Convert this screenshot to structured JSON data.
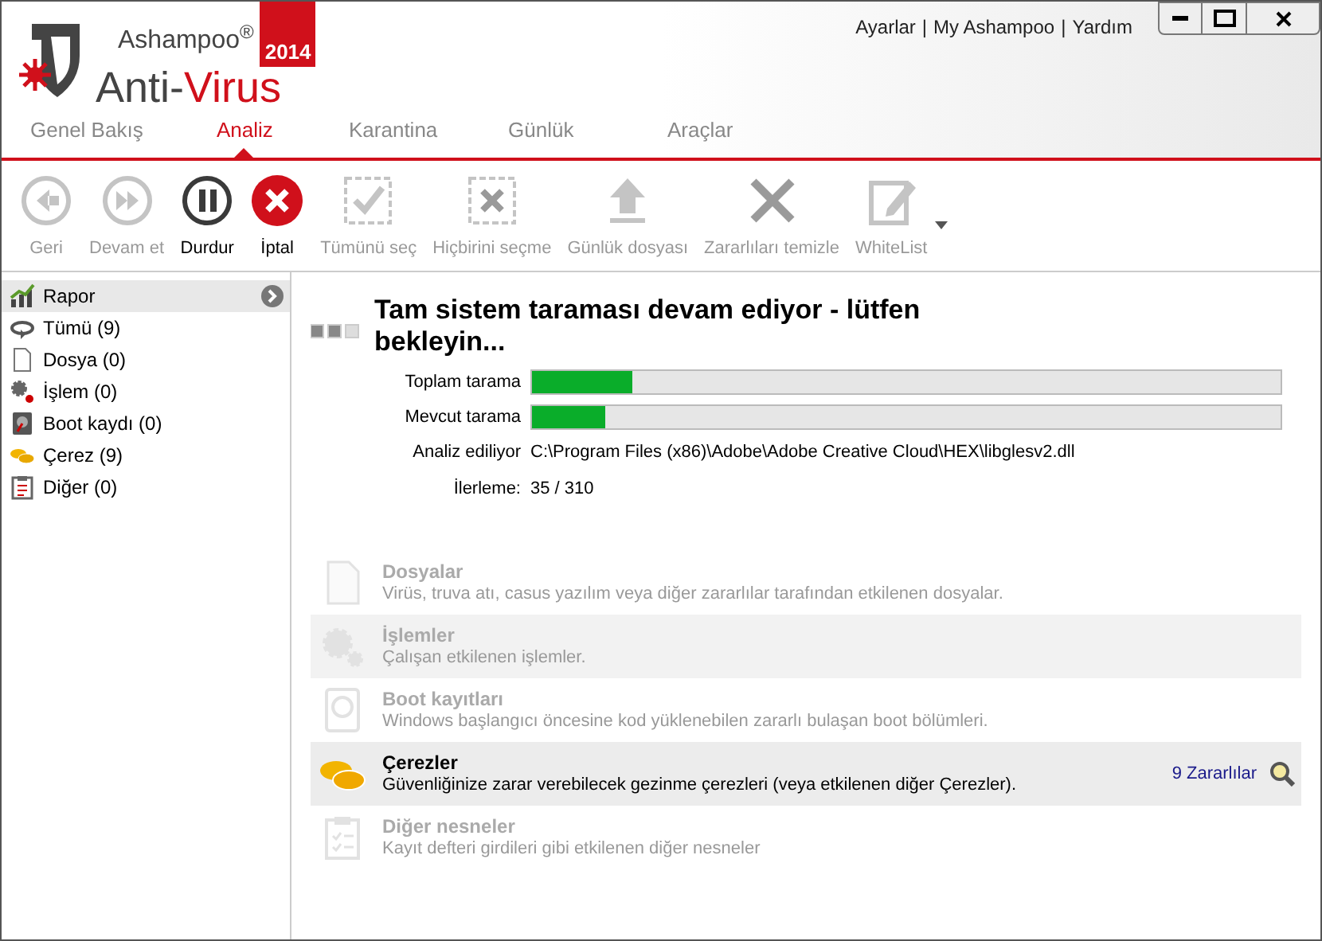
{
  "header": {
    "brand": "Ashampoo$^{®}$",
    "product_part_1": "Anti-",
    "product_part_2": "Virus",
    "year": "2014",
    "links": [
      "Ayarlar",
      "My Ashampoo",
      "Yardım"
    ],
    "separator": "|"
  },
  "tabs": [
    {
      "label": "Genel Bakış",
      "selected": false
    },
    {
      "label": "Analiz",
      "selected": true
    },
    {
      "label": "Karantina",
      "selected": false
    },
    {
      "label": "Günlük",
      "selected": false
    },
    {
      "label": "Araçlar",
      "selected": false
    }
  ],
  "toolbar": [
    {
      "kind": "back",
      "label": "Geri",
      "enabled": false
    },
    {
      "kind": "forward",
      "label": "Devam et",
      "enabled": false
    },
    {
      "kind": "pause",
      "label": "Durdur",
      "enabled": true
    },
    {
      "kind": "cancel",
      "label": "İptal",
      "enabled": true
    },
    {
      "kind": "check",
      "label": "Tümünü seç",
      "enabled": false
    },
    {
      "kind": "uncheck",
      "label": "Hiçbirini seçme",
      "enabled": false
    },
    {
      "kind": "upload",
      "label": "Günlük dosyası",
      "enabled": false
    },
    {
      "kind": "clean",
      "label": "Zararlıları temizle",
      "enabled": false
    },
    {
      "kind": "edit",
      "label": "WhiteList",
      "enabled": false
    }
  ],
  "sidebar": {
    "items": [
      {
        "kind": "report",
        "label": "Rapor",
        "selected": true
      },
      {
        "kind": "all",
        "label": "Tümü (9)",
        "selected": false
      },
      {
        "kind": "file",
        "label": "Dosya (0)",
        "selected": false
      },
      {
        "kind": "process",
        "label": "İşlem (0)",
        "selected": false
      },
      {
        "kind": "boot",
        "label": "Boot kaydı (0)",
        "selected": false
      },
      {
        "kind": "cookie",
        "label": "Çerez (9)",
        "selected": false
      },
      {
        "kind": "other",
        "label": "Diğer (0)",
        "selected": false
      }
    ]
  },
  "scan": {
    "title": "Tam sistem taraması devam ediyor - lütfen bekleyin...",
    "progress": [
      {
        "label": "Toplam tarama",
        "level": 0.135
      },
      {
        "label": "Mevcut tarama",
        "level": 0.098
      }
    ],
    "details": [
      {
        "label": "Analiz ediliyor",
        "value": "C:\\Program Files (x86)\\Adobe\\Adobe Creative Cloud\\HEX\\libglesv2.dll"
      },
      {
        "label": "İlerleme:",
        "value": "35 / 310"
      }
    ]
  },
  "categories": [
    {
      "kind": "file",
      "title": "Dosyalar",
      "description": "Virüs, truva atı, casus yazılım veya diğer zararlılar tarafından etkilenen dosyalar.",
      "enabled": false
    },
    {
      "kind": "process",
      "title": "İşlemler",
      "description": "Çalışan etkilenen işlemler.",
      "enabled": false
    },
    {
      "kind": "boot",
      "title": "Boot kayıtları",
      "description": "Windows başlangıcı öncesine kod yüklenebilen zararlı bulaşan boot bölümleri.",
      "enabled": false
    },
    {
      "kind": "cookie",
      "title": "Çerezler",
      "description": "Güvenliğinize zarar verebilecek gezinme çerezleri (veya etkilenen diğer Çerezler).",
      "enabled": true,
      "count": "9 Zararlılar"
    },
    {
      "kind": "other",
      "title": "Diğer nesneler",
      "description": "Kayıt defteri girdileri gibi etkilenen diğer nesneler",
      "enabled": false
    }
  ]
}
